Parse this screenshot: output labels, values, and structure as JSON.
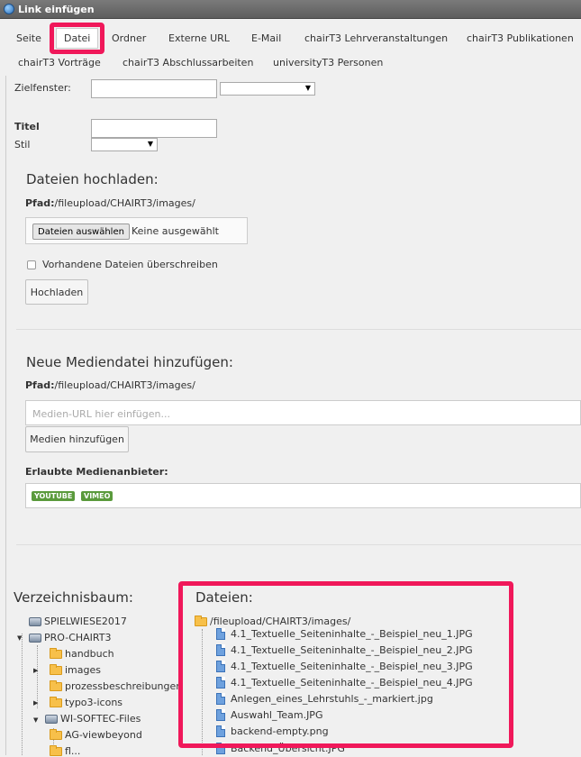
{
  "window": {
    "title": "Link einfügen"
  },
  "tabs": [
    {
      "label": "Seite"
    },
    {
      "label": "Datei"
    },
    {
      "label": "Ordner"
    },
    {
      "label": "Externe URL"
    },
    {
      "label": "E-Mail"
    },
    {
      "label": "chairT3 Lehrveranstaltungen"
    },
    {
      "label": "chairT3 Publikationen"
    },
    {
      "label": "chairT3 Vorträge"
    },
    {
      "label": "chairT3 Abschlussarbeiten"
    },
    {
      "label": "universityT3 Personen"
    }
  ],
  "form": {
    "target_label": "Zielfenster:",
    "title_label": "Titel",
    "style_label": "Stil"
  },
  "upload": {
    "heading": "Dateien hochladen:",
    "path_label": "Pfad:",
    "path_value": "/fileupload/CHAIRT3/images/",
    "choose_button": "Dateien auswählen",
    "none_selected": "Keine ausgewählt",
    "overwrite_label": "Vorhandene Dateien überschreiben",
    "upload_button": "Hochladen"
  },
  "media": {
    "heading": "Neue Mediendatei hinzufügen:",
    "path_label": "Pfad:",
    "path_value": "/fileupload/CHAIRT3/images/",
    "url_placeholder": "Medien-URL hier einfügen...",
    "add_button": "Medien hinzufügen",
    "providers_label": "Erlaubte Medienanbieter:",
    "providers": [
      "YOUTUBE",
      "VIMEO"
    ]
  },
  "tree": {
    "heading": "Verzeichnisbaum:",
    "items": [
      {
        "label": "SPIELWIESE2017",
        "icon": "server-icon"
      },
      {
        "label": "PRO-CHAIRT3",
        "icon": "server-icon"
      },
      {
        "label": "handbuch",
        "icon": "folder-icon"
      },
      {
        "label": "images",
        "icon": "folder-icon"
      },
      {
        "label": "prozessbeschreibungen",
        "icon": "folder-icon"
      },
      {
        "label": "typo3-icons",
        "icon": "folder-icon"
      },
      {
        "label": "WI-SOFTEC-Files",
        "icon": "server-icon"
      },
      {
        "label": "AG-viewbeyond",
        "icon": "folder-icon"
      },
      {
        "label": "fl...",
        "icon": "folder-icon"
      }
    ]
  },
  "files": {
    "heading": "Dateien:",
    "folder": "/fileupload/CHAIRT3/images/",
    "items": [
      {
        "name": "4.1_Textuelle_Seiteninhalte_-_Beispiel_neu_1.JPG"
      },
      {
        "name": "4.1_Textuelle_Seiteninhalte_-_Beispiel_neu_2.JPG"
      },
      {
        "name": "4.1_Textuelle_Seiteninhalte_-_Beispiel_neu_3.JPG"
      },
      {
        "name": "4.1_Textuelle_Seiteninhalte_-_Beispiel_neu_4.JPG"
      },
      {
        "name": "Anlegen_eines_Lehrstuhls_-_markiert.jpg"
      },
      {
        "name": "Auswahl_Team.JPG"
      },
      {
        "name": "backend-empty.png"
      },
      {
        "name": "Backend_Übersicht.JPG"
      }
    ]
  },
  "colors": {
    "highlight": "#f0185a",
    "badge": "#5a9a3c",
    "titlebar": "#6b6b6b"
  }
}
